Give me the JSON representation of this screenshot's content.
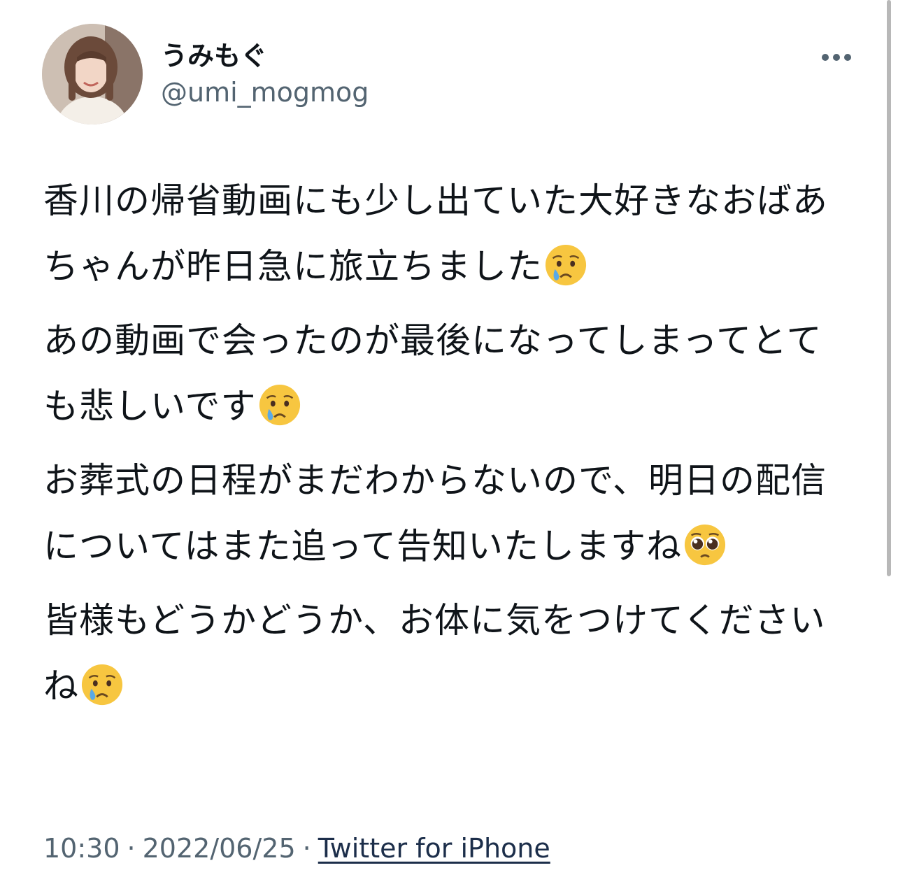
{
  "author": {
    "display_name": "うみもぐ",
    "handle": "@umi_mogmog"
  },
  "tweet": {
    "paragraphs": [
      {
        "text": "香川の帰省動画にも少し出ていた大好きなおばあちゃんが昨日急に旅立ちました",
        "emoji": "crying-face-emoji"
      },
      {
        "text": "あの動画で会ったのが最後になってしまってとても悲しいです",
        "emoji": "crying-face-emoji"
      },
      {
        "text": "お葬式の日程がまだわからないので、明日の配信についてはまた追って告知いたしますね",
        "emoji": "pleading-face-emoji"
      },
      {
        "text": "皆様もどうかどうか、お体に気をつけてくださいね",
        "emoji": "crying-face-emoji"
      }
    ]
  },
  "meta": {
    "time": "10:30",
    "date": "2022/06/25",
    "separator": "·",
    "source": "Twitter for iPhone"
  },
  "icons": {
    "more": "more-horizontal-icon"
  },
  "colors": {
    "text": "#0f1419",
    "secondary": "#536471",
    "emoji_face": "#f7c640",
    "tear": "#5aa9e6"
  }
}
